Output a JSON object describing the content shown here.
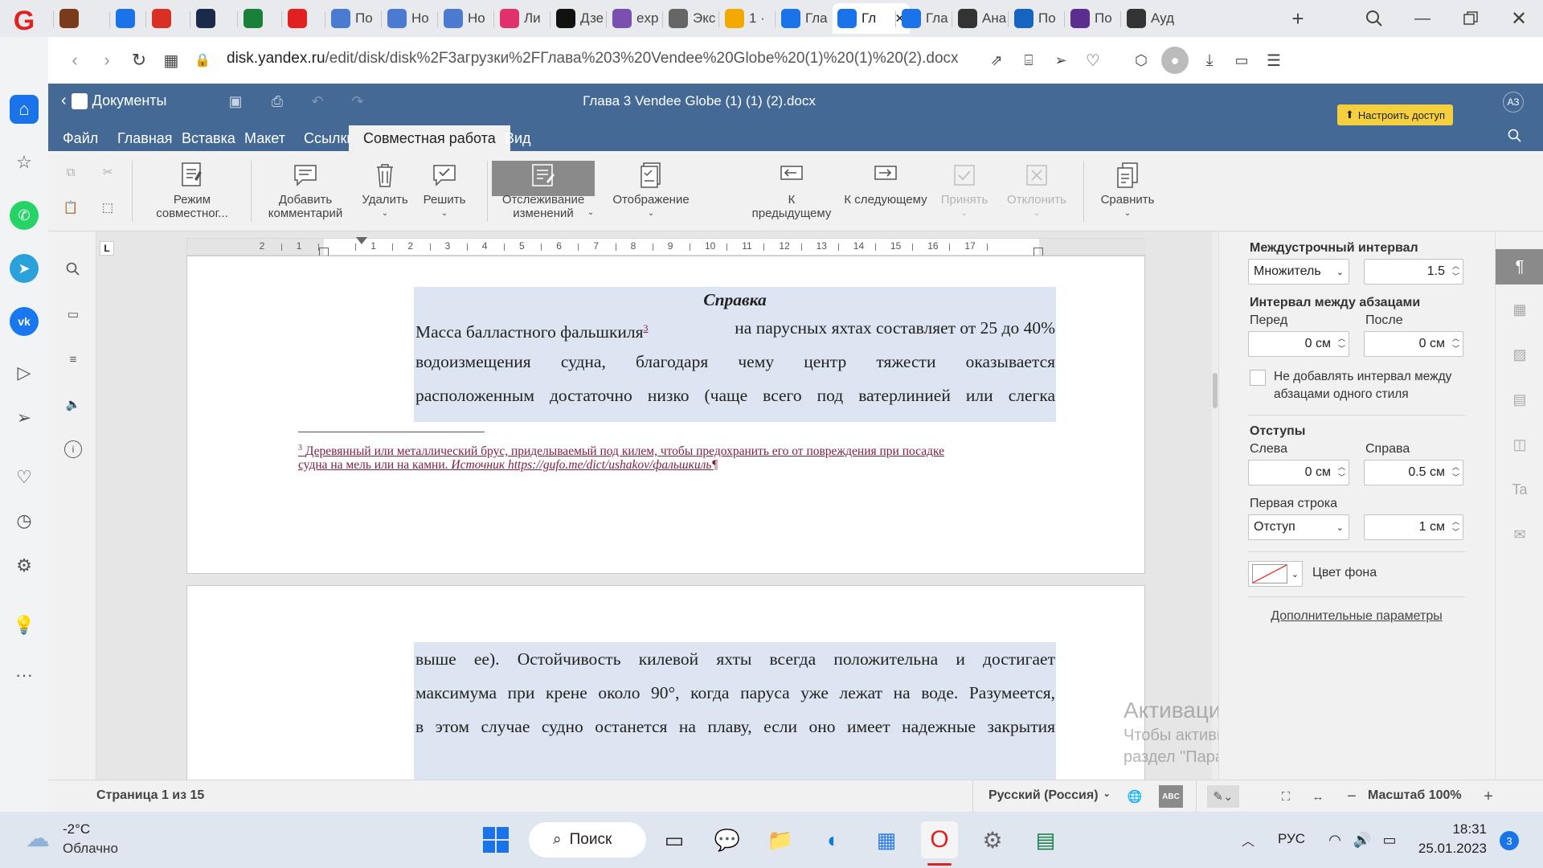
{
  "browser": {
    "tabs": [
      {
        "label": "",
        "icon": "painting-icon",
        "color": "#7a3b1a"
      },
      {
        "label": "",
        "icon": "yandex-t-icon",
        "color": "#1a73e8"
      },
      {
        "label": "",
        "icon": "s-icon",
        "color": "#d93025"
      },
      {
        "label": "",
        "icon": "globe-dark-icon",
        "color": "#1b2a4a"
      },
      {
        "label": "",
        "icon": "plus-green-icon",
        "color": "#188038"
      },
      {
        "label": "",
        "icon": "opera-icon",
        "color": "#e32020"
      },
      {
        "label": "По",
        "icon": "doc-icon",
        "color": "#4a7bd0"
      },
      {
        "label": "Но",
        "icon": "doc-icon",
        "color": "#4a7bd0"
      },
      {
        "label": "Но",
        "icon": "doc-icon",
        "color": "#4a7bd0"
      },
      {
        "label": "Ли",
        "icon": "dots-icon",
        "color": "#e1306c"
      },
      {
        "label": "Дзе",
        "icon": "dzen-icon",
        "color": "#111111"
      },
      {
        "label": "exp",
        "icon": "cube-icon",
        "color": "#7a4fb0"
      },
      {
        "label": "Экс",
        "icon": "grid-icon",
        "color": "#666666"
      },
      {
        "label": "1 ·",
        "icon": "mail-icon",
        "color": "#f2a900"
      },
      {
        "label": "Гла",
        "icon": "doc-icon",
        "color": "#1a73e8"
      },
      {
        "label": "Гл",
        "icon": "doc-icon",
        "color": "#1a73e8",
        "active": true
      },
      {
        "label": "Гла",
        "icon": "doc-icon",
        "color": "#1a73e8"
      },
      {
        "label": "Ана",
        "icon": "pause-icon",
        "color": "#333333"
      },
      {
        "label": "По",
        "icon": "h-icon",
        "color": "#1565c0"
      },
      {
        "label": "По",
        "icon": "notion-icon",
        "color": "#5b2d90"
      },
      {
        "label": "Ауд",
        "icon": "t-circle-icon",
        "color": "#333333"
      }
    ],
    "url_host": "disk.yandex.ru",
    "url_path": "/edit/disk/disk%2F3агрузки%2FГлава%203%20Vendee%20Globe%20(1)%20(1)%20(2).docx"
  },
  "app": {
    "name": "Документы",
    "doc_title": "Глава 3 Vendee Globe (1) (1) (2).docx",
    "share_button": "Настроить доступ",
    "avatar": "АЗ",
    "menu": [
      "Файл",
      "Главная",
      "Вставка",
      "Макет",
      "Ссылки",
      "Совместная работа",
      "Вид"
    ],
    "active_menu": "Совместная работа"
  },
  "toolbar": {
    "co_mode": "Режим совместног...",
    "add_comment": "Добавить комментарий",
    "delete": "Удалить",
    "resolve": "Решить",
    "track_changes": "Отслеживание изменений",
    "display": "Отображение",
    "prev": "К предыдущему",
    "next": "К следующему",
    "accept": "Принять",
    "reject": "Отклонить",
    "compare": "Сравнить"
  },
  "ruler": {
    "numbers": [
      "2",
      "1",
      "1",
      "2",
      "3",
      "4",
      "5",
      "6",
      "7",
      "8",
      "9",
      "10",
      "11",
      "12",
      "13",
      "14",
      "15",
      "16",
      "17"
    ]
  },
  "document": {
    "heading": "Справка",
    "page1_lines": [
      "Масса балластного фальшкиля",
      "водоизмещения судна, благодаря чему центр тяжести оказывается",
      "расположенным достаточно низко (чаще всего под ватерлинией или слегка"
    ],
    "line1_tail": " на парусных яхтах составляет от 25 до 40%",
    "footnote_ref": "3",
    "footnote_line1": "Деревянный или металлический брус, приделываемый под килем, чтобы предохранить его от повреждения при посадке",
    "footnote_line2": "судна на мель или на камни.",
    "footnote_source_label": "Источник",
    "footnote_source_url": "https://gufo.me/dict/ushakov/фальшкиль¶",
    "page2_lines": [
      "выше ее). Остойчивость килевой яхты всегда положительна и достигает",
      "максимума при крене около 90°, когда паруса уже лежат на воде. Разумеется,",
      "в этом случае судно останется на плаву, если оно имеет надежные закрытия"
    ]
  },
  "right_panel": {
    "line_spacing_label": "Междустрочный интервал",
    "line_spacing_type": "Множитель",
    "line_spacing_value": "1.5",
    "para_spacing_label": "Интервал между абзацами",
    "before_label": "Перед",
    "after_label": "После",
    "before_value": "0 см",
    "after_value": "0 см",
    "no_interval_label": "Не добавлять интервал между абзацами одного стиля",
    "indents_label": "Отступы",
    "left_label": "Слева",
    "right_label": "Справа",
    "left_value": "0 см",
    "right_value": "0.5 см",
    "first_line_label": "Первая строка",
    "first_line_type": "Отступ",
    "first_line_value": "1 см",
    "bg_color_label": "Цвет фона",
    "more_params": "Дополнительные параметры"
  },
  "statusbar": {
    "page": "Страница 1 из 15",
    "language": "Русский (Россия)",
    "zoom": "Масштаб 100%"
  },
  "watermark": {
    "title": "Активация Windows",
    "line1": "Чтобы активировать Windows, перейдите в",
    "line2": "раздел \"Параметры\"."
  },
  "taskbar": {
    "temp": "-2°C",
    "weather": "Облачно",
    "search": "Поиск",
    "lang": "РУС",
    "time": "18:31",
    "date": "25.01.2023",
    "notifications": "3"
  }
}
